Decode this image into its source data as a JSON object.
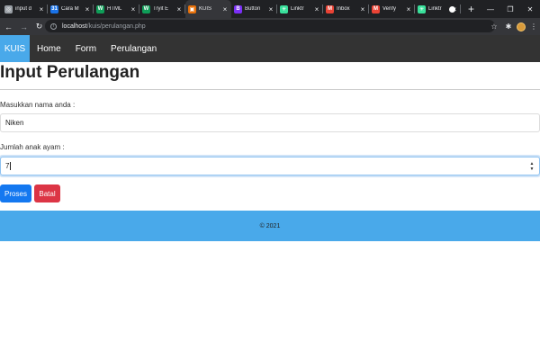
{
  "browser": {
    "tabs": [
      {
        "title": "input d",
        "favicon_color": "#9aa0a6",
        "favicon_glyph": "◎",
        "active": false
      },
      {
        "title": "Cara M",
        "favicon_color": "#1a73e8",
        "favicon_glyph": "31",
        "active": false
      },
      {
        "title": "HTML",
        "favicon_color": "#0f9d58",
        "favicon_glyph": "W",
        "active": false
      },
      {
        "title": "Tryit E",
        "favicon_color": "#0f9d58",
        "favicon_glyph": "W",
        "active": false
      },
      {
        "title": "KUIS",
        "favicon_color": "#e8710a",
        "favicon_glyph": "▣",
        "active": true
      },
      {
        "title": "Button",
        "favicon_color": "#7b2ff7",
        "favicon_glyph": "B",
        "active": false
      },
      {
        "title": "Linktr",
        "favicon_color": "#39e09b",
        "favicon_glyph": "✳",
        "active": false
      },
      {
        "title": "Inbox",
        "favicon_color": "#ea4335",
        "favicon_glyph": "M",
        "active": false
      },
      {
        "title": "Verify",
        "favicon_color": "#ea4335",
        "favicon_glyph": "M",
        "active": false
      },
      {
        "title": "Linktr",
        "favicon_color": "#39e09b",
        "favicon_glyph": "✳",
        "active": false
      }
    ],
    "new_tab_glyph": "+",
    "url_host": "localhost",
    "url_path": "/kuis/perulangan.php"
  },
  "navbar": {
    "brand": "KUIS",
    "links": [
      "Home",
      "Form",
      "Perulangan"
    ]
  },
  "main": {
    "title": "Input Perulangan",
    "name_label": "Masukkan nama anda :",
    "name_value": "Niken",
    "count_label": "Jumlah anak ayam :",
    "count_value": "7",
    "submit_label": "Proses",
    "cancel_label": "Batal"
  },
  "footer": {
    "text": "© 2021"
  },
  "colors": {
    "brand_accent": "#49a9ea",
    "primary": "#1478f0",
    "danger": "#dc3545"
  }
}
